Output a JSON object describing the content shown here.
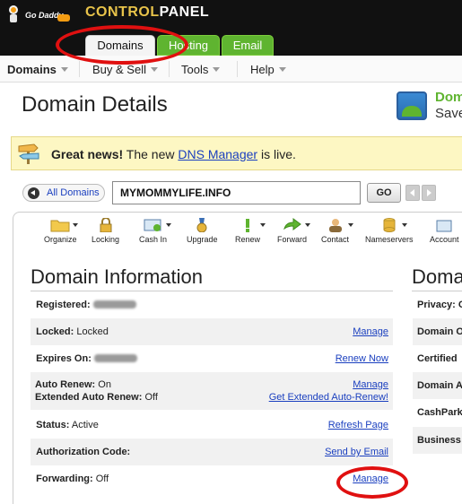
{
  "brand": {
    "logo_name": "Go Daddy",
    "control_prefix": "CONTROL",
    "control_suffix": "PANEL"
  },
  "top_tabs": [
    "Domains",
    "Hosting",
    "Email"
  ],
  "subnav": [
    "Domains",
    "Buy & Sell",
    "Tools",
    "Help"
  ],
  "header": {
    "title": "Domain Details",
    "promo_line1": "Dom",
    "promo_line2": "Save"
  },
  "notice": {
    "bold": "Great news!",
    "pre": " The new ",
    "link": "DNS Manager",
    "post": " is live."
  },
  "selector": {
    "all_domains": "All Domains",
    "domain": "MYMOMMYLIFE.INFO",
    "go": "GO"
  },
  "toolbar": [
    {
      "label": "Organize",
      "icon": "folder-icon"
    },
    {
      "label": "Locking",
      "icon": "lock-icon"
    },
    {
      "label": "Cash In",
      "icon": "cash-in-icon"
    },
    {
      "label": "Upgrade",
      "icon": "upgrade-medal-icon"
    },
    {
      "label": "Renew",
      "icon": "renew-icon"
    },
    {
      "label": "Forward",
      "icon": "forward-arrow-icon"
    },
    {
      "label": "Contact",
      "icon": "contact-person-icon"
    },
    {
      "label": "Nameservers",
      "icon": "nameservers-database-icon"
    },
    {
      "label": "Account",
      "icon": "account-icon"
    }
  ],
  "domain_info": {
    "title": "Domain Information",
    "registered_label": "Registered:",
    "locked_label": "Locked:",
    "locked_value": "Locked",
    "locked_link": "Manage",
    "expires_label": "Expires On:",
    "expires_link": "Renew Now",
    "auto_renew_label": "Auto Renew:",
    "auto_renew_value": "On",
    "auto_renew_link": "Manage",
    "ext_auto_renew_label": "Extended Auto Renew:",
    "ext_auto_renew_value": "Off",
    "ext_auto_renew_link": "Get Extended Auto-Renew!",
    "status_label": "Status:",
    "status_value": "Active",
    "status_link": "Refresh Page",
    "auth_label": "Authorization Code:",
    "auth_link": "Send by Email",
    "forwarding_label": "Forwarding:",
    "forwarding_value": "Off",
    "forwarding_link": "Manage"
  },
  "right_panel": {
    "title": "Doma",
    "rows": [
      "Privacy: O",
      "Domain O",
      "Certified",
      "Domain A",
      "CashPark",
      "Business"
    ]
  },
  "colors": {
    "tab_green": "#5fb430",
    "annotation_red": "#e01010",
    "link_blue": "#1a3fbf",
    "notice_yellow": "#fdf7c3"
  }
}
